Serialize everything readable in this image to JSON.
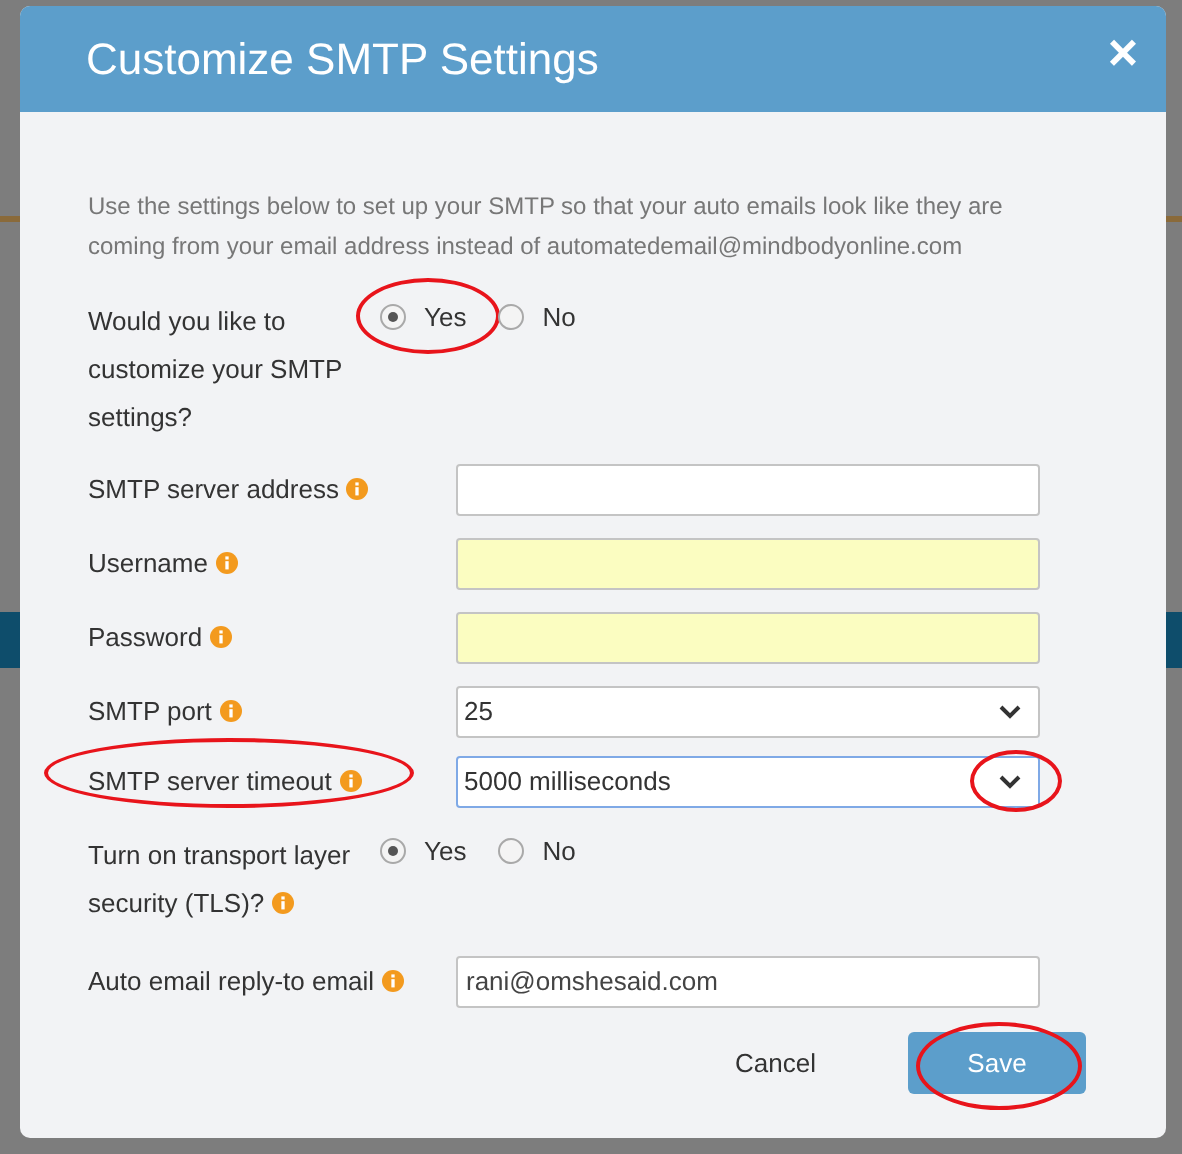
{
  "dialog": {
    "title": "Customize SMTP Settings",
    "close": "×",
    "intro": "Use the settings below to set up your SMTP so that your auto emails look like they are coming from your email address instead of automatedemail@mindbodyonline.com",
    "fields": [
      {
        "kind": "radio",
        "label": "Would you like to customize your SMTP settings?",
        "options": [
          {
            "label": "Yes",
            "selected": true,
            "circled": true
          },
          {
            "label": "No",
            "selected": false
          }
        ]
      },
      {
        "kind": "text",
        "label": "SMTP server address",
        "info": true,
        "autofill": false
      },
      {
        "kind": "text",
        "label": "Username",
        "info": true,
        "autofill": true
      },
      {
        "kind": "text",
        "label": "Password",
        "info": true,
        "autofill": true
      },
      {
        "kind": "select",
        "label": "SMTP port",
        "info": true,
        "value": "25",
        "focused": false
      },
      {
        "kind": "select",
        "label": "SMTP server timeout",
        "info": true,
        "value": "5000 milliseconds",
        "focused": true,
        "label_circled": true,
        "arrow_circled": true
      },
      {
        "kind": "radio",
        "label": "Turn on transport layer security (TLS)?",
        "info": true,
        "options": [
          {
            "label": "Yes",
            "selected": true
          },
          {
            "label": "No",
            "selected": false
          }
        ]
      },
      {
        "kind": "text",
        "label": "Auto email reply-to email",
        "info": true,
        "value": "rani@omshesaid.com",
        "autofill": false
      }
    ],
    "cancel": "Cancel",
    "save": {
      "label": "Save",
      "circled": true
    }
  }
}
